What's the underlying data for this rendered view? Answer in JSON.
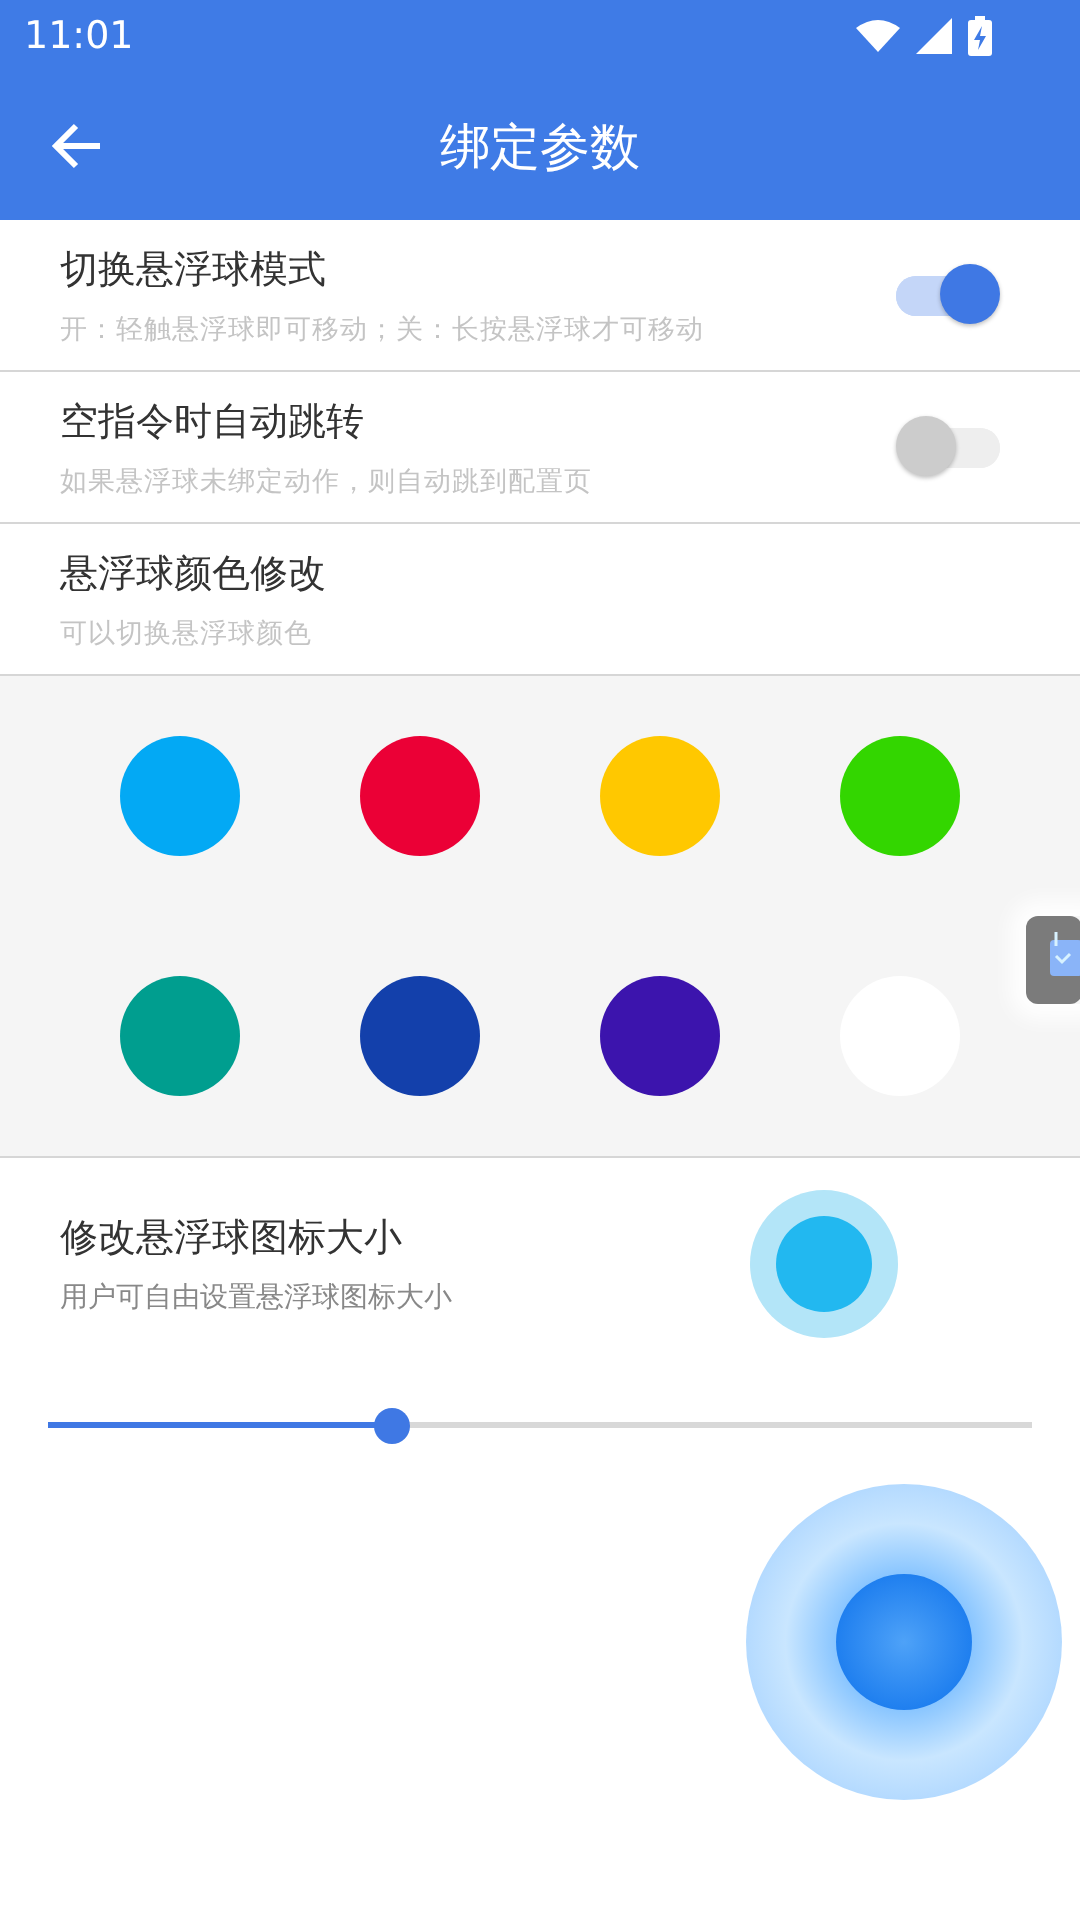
{
  "status_bar": {
    "time": "11:01"
  },
  "app_bar": {
    "title": "绑定参数"
  },
  "settings": [
    {
      "kind": "switch",
      "title": "切换悬浮球模式",
      "subtitle": "开：轻触悬浮球即可移动；关：长按悬浮球才可移动",
      "on": true
    },
    {
      "kind": "switch",
      "title": "空指令时自动跳转",
      "subtitle": "如果悬浮球未绑定动作，则自动跳到配置页",
      "on": false
    },
    {
      "kind": "header",
      "title": "悬浮球颜色修改",
      "subtitle": "可以切换悬浮球颜色"
    }
  ],
  "colors": [
    {
      "color": "#03a9f4"
    },
    {
      "color": "#eb0036"
    },
    {
      "color": "#ffc800"
    },
    {
      "color": "#33d600"
    },
    {
      "color": "#009e8f"
    },
    {
      "color": "#1340ab"
    },
    {
      "color": "#3c14ad"
    },
    {
      "color": "#ffffff"
    }
  ],
  "size": {
    "title": "修改悬浮球图标大小",
    "subtitle": "用户可自由设置悬浮球图标大小",
    "level": 0.35
  }
}
